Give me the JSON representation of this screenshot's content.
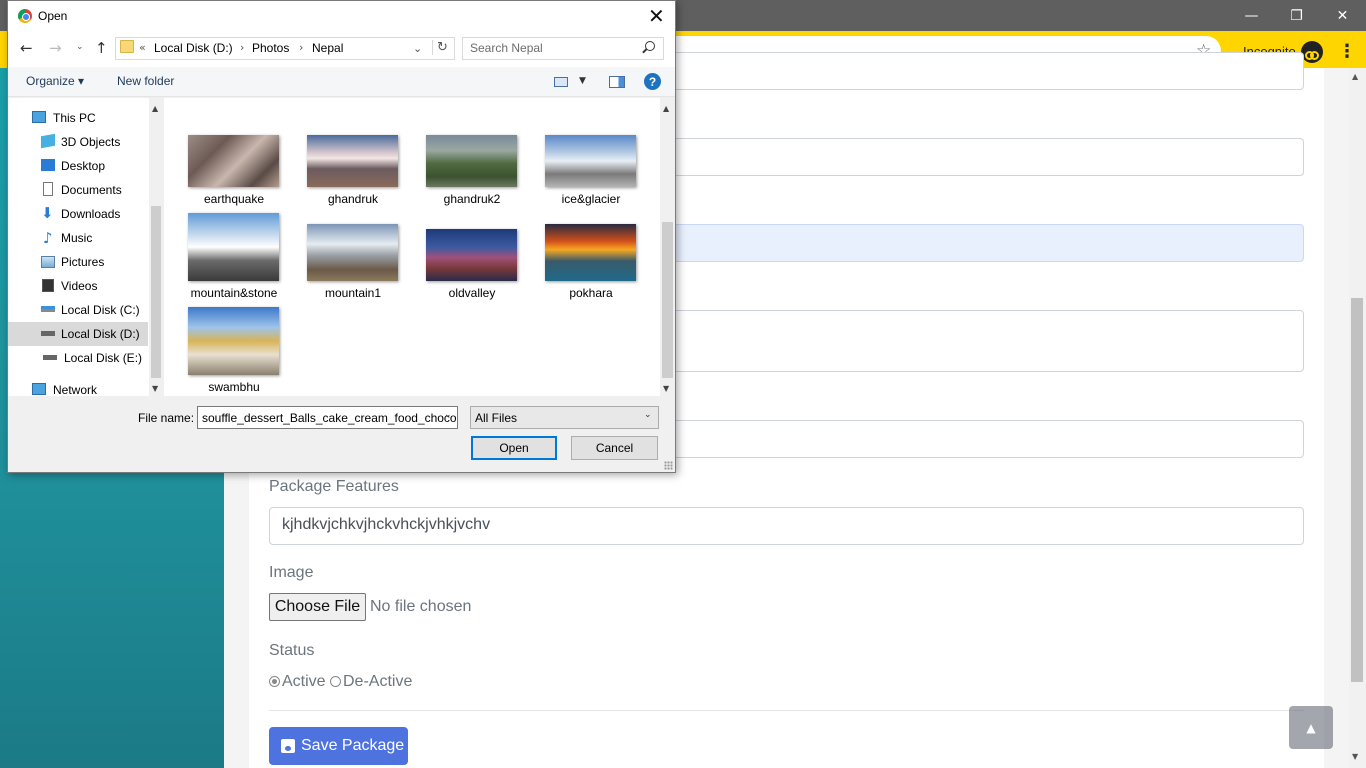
{
  "browser": {
    "incognito_label": "Incognito",
    "window_controls": [
      "minimize-icon",
      "restore-icon",
      "close-icon"
    ],
    "accent": "#ffd500"
  },
  "page": {
    "labels": {
      "package_features": "Package Features",
      "image": "Image",
      "status": "Status"
    },
    "package_features_value": "kjhdkvjchkvjhckvhckjvhkjvchv",
    "choose_file": "Choose File",
    "no_file": "No file chosen",
    "status_options": [
      {
        "label": "Active",
        "checked": true
      },
      {
        "label": "De-Active",
        "checked": false
      }
    ],
    "save_button": "Save Package",
    "save_color": "#4e73df"
  },
  "dialog": {
    "title": "Open",
    "breadcrumb": [
      "Local Disk (D:)",
      "Photos",
      "Nepal"
    ],
    "breadcrumb_prefix": "«",
    "search_placeholder": "Search Nepal",
    "organize": "Organize ▾",
    "new_folder": "New folder",
    "help": "?",
    "nav_items": [
      {
        "label": "This PC",
        "icon": "computer-icon"
      },
      {
        "label": "3D Objects",
        "icon": "cube-icon"
      },
      {
        "label": "Desktop",
        "icon": "desktop-icon"
      },
      {
        "label": "Documents",
        "icon": "document-icon"
      },
      {
        "label": "Downloads",
        "icon": "download-icon"
      },
      {
        "label": "Music",
        "icon": "music-icon"
      },
      {
        "label": "Pictures",
        "icon": "pictures-icon"
      },
      {
        "label": "Videos",
        "icon": "video-icon"
      },
      {
        "label": "Local Disk (C:)",
        "icon": "drive-icon"
      },
      {
        "label": "Local Disk (D:)",
        "icon": "drive-icon",
        "selected": true
      },
      {
        "label": "Local Disk (E:)",
        "icon": "drive-icon"
      },
      {
        "label": "Network",
        "icon": "network-icon"
      }
    ],
    "files": [
      "earthquake",
      "ghandruk",
      "ghandruk2",
      "ice&glacier",
      "mountain&stone",
      "mountain1",
      "oldvalley",
      "pokhara",
      "swambhu"
    ],
    "file_name_label": "File name:",
    "file_name_value": "souffle_dessert_Balls_cake_cream_food_chocolate",
    "file_type": "All Files",
    "open_button": "Open",
    "cancel_button": "Cancel"
  }
}
